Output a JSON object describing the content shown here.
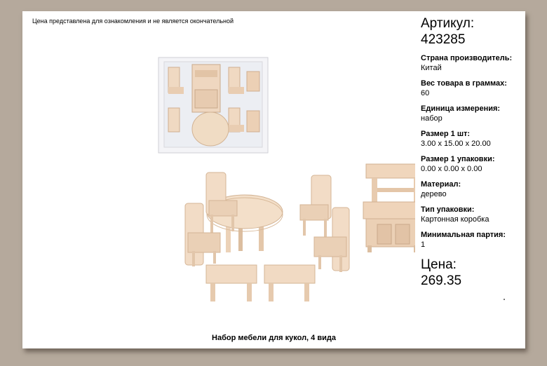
{
  "disclaimer": "Цена представлена для ознакомления и не является окончательной",
  "article": {
    "label": "Артикул:",
    "value": "423285"
  },
  "fields": [
    {
      "label": "Страна производитель:",
      "value": "Китай"
    },
    {
      "label": "Вес товара в граммах:",
      "value": "60"
    },
    {
      "label": "Единица измерения:",
      "value": "набор"
    },
    {
      "label": "Размер 1 шт:",
      "value": "3.00 x 15.00 x 20.00"
    },
    {
      "label": "Размер 1 упаковки:",
      "value": "0.00 x 0.00 x 0.00"
    },
    {
      "label": "Материал:",
      "value": "дерево"
    },
    {
      "label": "Тип упаковки:",
      "value": "Картонная коробка"
    },
    {
      "label": "Минимальная партия:",
      "value": "1"
    }
  ],
  "price": {
    "label": "Цена:",
    "value": "269.35"
  },
  "caption": "Набор мебели для кукол, 4 вида",
  "colors": {
    "background": "#b5a99c",
    "wood": "#f0d9c2",
    "wood_dark": "#d9bca0"
  }
}
